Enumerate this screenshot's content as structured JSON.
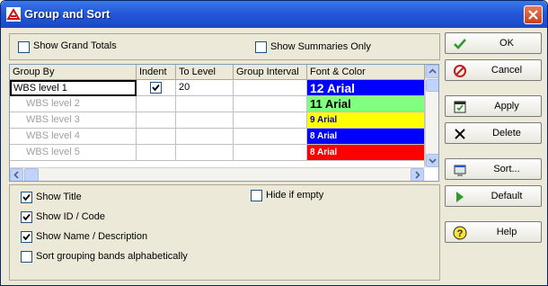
{
  "window": {
    "title": "Group and Sort"
  },
  "options_top": {
    "show_grand_totals": {
      "label": "Show Grand Totals",
      "checked": false
    },
    "show_summaries_only": {
      "label": "Show Summaries Only",
      "checked": false
    }
  },
  "grid": {
    "columns": [
      "Group By",
      "Indent",
      "To Level",
      "Group Interval",
      "Font & Color"
    ],
    "rows": [
      {
        "group_by": "WBS level 1",
        "indent": true,
        "to_level": "20",
        "interval": "",
        "font": "12 Arial",
        "font_bg": "#0000ff",
        "font_color": "#ffffff",
        "font_size": "big"
      },
      {
        "group_by": "WBS level 2",
        "indent": false,
        "to_level": "",
        "interval": "",
        "font": "11 Arial",
        "font_bg": "#80ff80",
        "font_color": "#000000",
        "font_size": "medium"
      },
      {
        "group_by": "WBS level 3",
        "indent": false,
        "to_level": "",
        "interval": "",
        "font": "9 Arial",
        "font_bg": "#ffff00",
        "font_color": "#0000c0",
        "font_size": "small"
      },
      {
        "group_by": "WBS level 4",
        "indent": false,
        "to_level": "",
        "interval": "",
        "font": "8 Arial",
        "font_bg": "#0000ff",
        "font_color": "#ffffff",
        "font_size": "small"
      },
      {
        "group_by": "WBS level 5",
        "indent": false,
        "to_level": "",
        "interval": "",
        "font": "8 Arial",
        "font_bg": "#ff0000",
        "font_color": "#ffffff",
        "font_size": "small"
      }
    ]
  },
  "options_bottom": {
    "show_title": {
      "label": "Show Title",
      "checked": true
    },
    "hide_if_empty": {
      "label": "Hide if empty",
      "checked": false
    },
    "show_id_code": {
      "label": "Show ID / Code",
      "checked": true
    },
    "show_name_desc": {
      "label": "Show Name / Description",
      "checked": true
    },
    "sort_alpha": {
      "label": "Sort grouping bands alphabetically",
      "checked": false
    }
  },
  "buttons": {
    "ok": "OK",
    "cancel": "Cancel",
    "apply": "Apply",
    "delete": "Delete",
    "sort": "Sort...",
    "default": "Default",
    "help": "Help"
  },
  "colors": {
    "titlebar": "#2358d8",
    "accent": "#0a246a"
  }
}
